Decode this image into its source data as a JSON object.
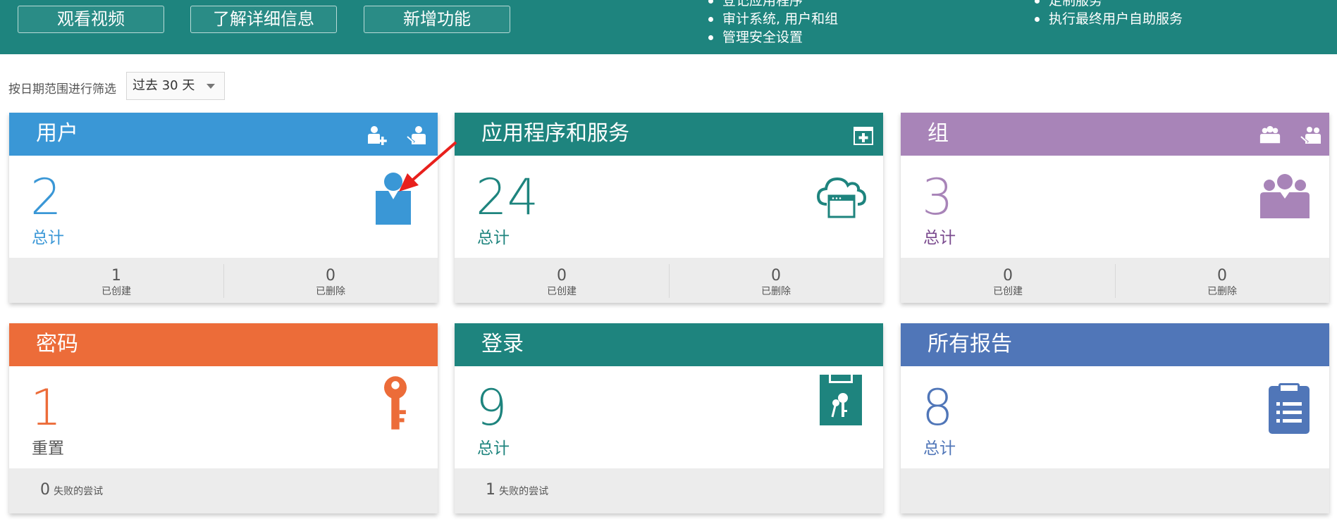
{
  "banner": {
    "buttons": [
      "观看视频",
      "了解详细信息",
      "新增功能"
    ],
    "features_left": [
      "登记应用程序",
      "审计系统, 用户和组",
      "管理安全设置"
    ],
    "features_right": [
      "定制服务",
      "执行最终用户自助服务"
    ]
  },
  "filter": {
    "label": "按日期范围进行筛选",
    "selected": "过去 30 天"
  },
  "colors": {
    "banner": "#1e847e",
    "users": "#3a97d6",
    "apps": "#1e847e",
    "groups": "#a884b8",
    "passwords": "#ec6c39",
    "logins": "#1e847e",
    "reports": "#5076b8",
    "arrow": "#e8201c"
  },
  "cards": {
    "users": {
      "title": "用户",
      "total": "2",
      "total_label": "总计",
      "created": "1",
      "created_label": "已创建",
      "deleted": "0",
      "deleted_label": "已删除",
      "icons": [
        "add-user-icon",
        "import-user-icon",
        "user-icon"
      ]
    },
    "apps": {
      "title": "应用程序和服务",
      "total": "24",
      "total_label": "总计",
      "created": "0",
      "created_label": "已创建",
      "deleted": "0",
      "deleted_label": "已删除",
      "icons": [
        "add-app-icon",
        "cloud-app-icon"
      ]
    },
    "groups": {
      "title": "组",
      "total": "3",
      "total_label": "总计",
      "created": "0",
      "created_label": "已创建",
      "deleted": "0",
      "deleted_label": "已删除",
      "icons": [
        "add-group-icon",
        "import-group-icon",
        "group-icon"
      ]
    },
    "passwords": {
      "title": "密码",
      "total": "1",
      "total_label": "重置",
      "failed": "0",
      "failed_label": "失败的尝试",
      "icons": [
        "key-icon"
      ]
    },
    "logins": {
      "title": "登录",
      "total": "9",
      "total_label": "总计",
      "failed": "1",
      "failed_label": "失败的尝试",
      "icons": [
        "login-keys-icon"
      ]
    },
    "reports": {
      "title": "所有报告",
      "total": "8",
      "total_label": "总计",
      "icons": [
        "report-clipboard-icon"
      ]
    }
  }
}
